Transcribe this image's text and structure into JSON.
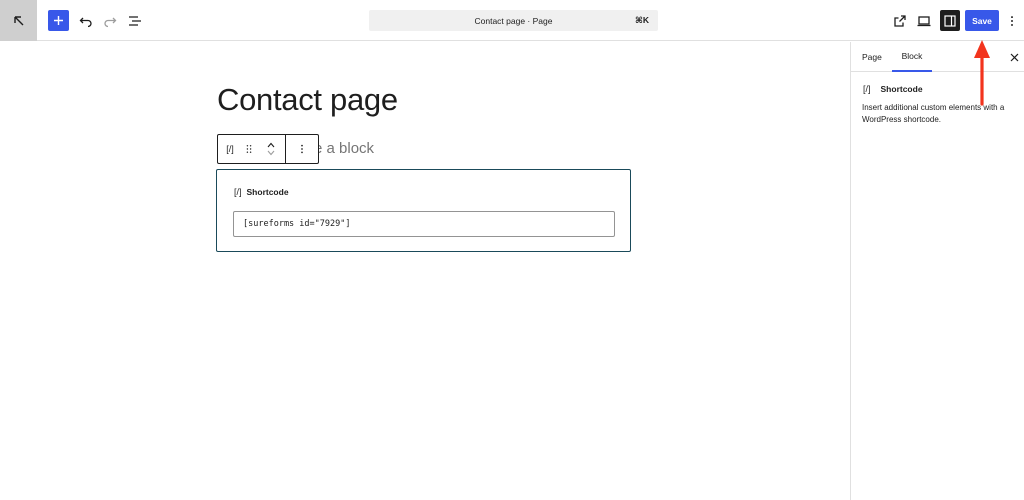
{
  "topbar": {
    "command_title": "Contact page · Page",
    "command_shortcut": "⌘K",
    "save_label": "Save"
  },
  "editor": {
    "page_title": "Contact page",
    "placeholder_fragment": "e a block",
    "block_toolbar": {
      "type_icon": "[/]",
      "drag_icon": "⠿",
      "more_icon": "⋮"
    },
    "shortcode_block": {
      "icon": "[/]",
      "label": "Shortcode",
      "value": "[sureforms id=\"7929\"]"
    }
  },
  "sidebar": {
    "tabs": [
      {
        "label": "Page",
        "active": false
      },
      {
        "label": "Block",
        "active": true
      }
    ],
    "block_icon": "[/]",
    "block_name": "Shortcode",
    "block_description": "Insert additional custom elements with a WordPress shortcode."
  },
  "colors": {
    "accent": "#3858e9",
    "annotation_arrow": "#f2341d",
    "block_border": "#1a4a5a"
  }
}
